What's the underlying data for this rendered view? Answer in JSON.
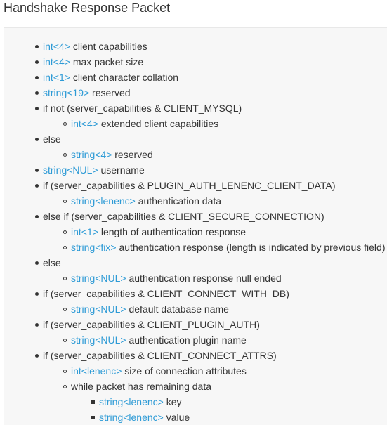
{
  "title": "Handshake Response Packet",
  "items": [
    {
      "type": "int<4>",
      "text": " client capabilities"
    },
    {
      "type": "int<4>",
      "text": " max packet size"
    },
    {
      "type": "int<1>",
      "text": " client character collation"
    },
    {
      "type": "string<19>",
      "text": " reserved"
    },
    {
      "type": "",
      "text": "if not (server_capabilities & CLIENT_MYSQL)",
      "children": [
        {
          "type": "int<4>",
          "text": " extended client capabilities"
        }
      ]
    },
    {
      "type": "",
      "text": "else",
      "children": [
        {
          "type": "string<4>",
          "text": " reserved"
        }
      ]
    },
    {
      "type": "string<NUL>",
      "text": " username"
    },
    {
      "type": "",
      "text": "if (server_capabilities & PLUGIN_AUTH_LENENC_CLIENT_DATA)",
      "children": [
        {
          "type": "string<lenenc>",
          "text": " authentication data"
        }
      ]
    },
    {
      "type": "",
      "text": "else if (server_capabilities & CLIENT_SECURE_CONNECTION)",
      "children": [
        {
          "type": "int<1>",
          "text": " length of authentication response"
        },
        {
          "type": "string<fix>",
          "text": " authentication response (length is indicated by previous field)"
        }
      ]
    },
    {
      "type": "",
      "text": "else",
      "children": [
        {
          "type": "string<NUL>",
          "text": " authentication response null ended"
        }
      ]
    },
    {
      "type": "",
      "text": "if (server_capabilities & CLIENT_CONNECT_WITH_DB)",
      "children": [
        {
          "type": "string<NUL>",
          "text": " default database name"
        }
      ]
    },
    {
      "type": "",
      "text": "if (server_capabilities & CLIENT_PLUGIN_AUTH)",
      "children": [
        {
          "type": "string<NUL>",
          "text": " authentication plugin name"
        }
      ]
    },
    {
      "type": "",
      "text": "if (server_capabilities & CLIENT_CONNECT_ATTRS)",
      "children": [
        {
          "type": "int<lenenc>",
          "text": " size of connection attributes"
        },
        {
          "type": "",
          "text": "while packet has remaining data",
          "children": [
            {
              "type": "string<lenenc>",
              "text": " key"
            },
            {
              "type": "string<lenenc>",
              "text": " value"
            }
          ]
        }
      ]
    }
  ]
}
